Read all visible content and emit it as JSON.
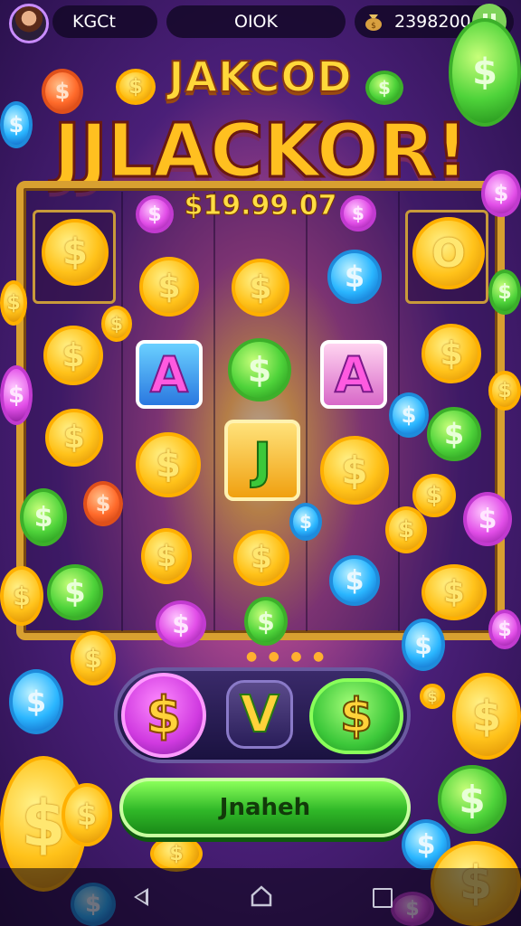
{
  "header": {
    "player_name": "KGCt",
    "center_label": "OIOK",
    "balance": "2398200"
  },
  "title": {
    "top": "JAKCOD",
    "main": "JJLACKOR!",
    "amount": "$19.99.07"
  },
  "reels": {
    "coin_symbol": "$",
    "special_tiles": [
      "A",
      "J",
      "A"
    ],
    "corner_symbol": "O"
  },
  "controls": {
    "left_symbol": "$",
    "middle_symbol": "V",
    "right_symbol": "$",
    "action_label": "Jnaheh"
  },
  "colors": {
    "gold": "#ffc21a",
    "green": "#4ed33a",
    "pink": "#e24ee8",
    "blue": "#2ab6ff",
    "frame": "#d8a030"
  }
}
